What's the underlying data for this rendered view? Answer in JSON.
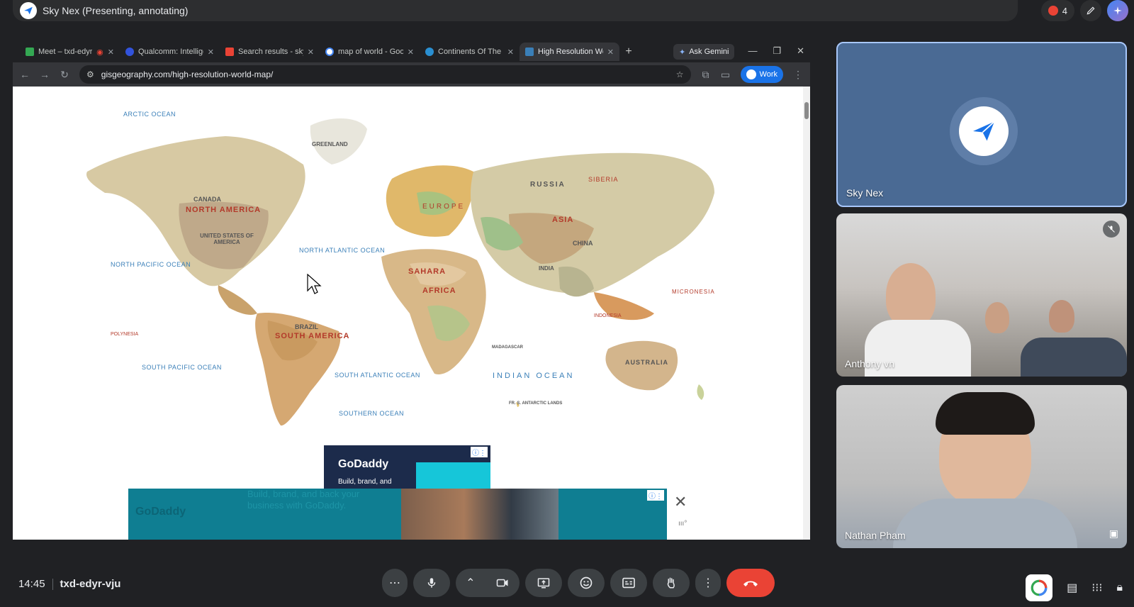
{
  "meet": {
    "presenter_title": "Sky Nex (Presenting, annotating)",
    "participant_count": "4",
    "time": "14:45",
    "meeting_code": "txd-edyr-vju"
  },
  "browser": {
    "tabs": [
      {
        "label": "Meet – txd-edyr",
        "color": "#34a853"
      },
      {
        "label": "Qualcomm: Intellige",
        "color": "#3253dc"
      },
      {
        "label": "Search results - sky",
        "color": "#ea4335"
      },
      {
        "label": "map of world - Goo",
        "color": "#4285f4"
      },
      {
        "label": "Continents Of The W",
        "color": "#2a8fd1"
      },
      {
        "label": "High Resolution Wo",
        "color": "#3a7fb8"
      }
    ],
    "ask_gemini": "Ask Gemini",
    "url": "gisgeography.com/high-resolution-world-map/",
    "profile": "Work"
  },
  "map_labels": {
    "arctic": "ARCTIC OCEAN",
    "greenland": "GREENLAND",
    "russia": "RUSSIA",
    "siberia": "SIBERIA",
    "canada": "CANADA",
    "north_america": "NORTH AMERICA",
    "usa": "UNITED STATES OF AMERICA",
    "north_atlantic": "NORTH ATLANTIC OCEAN",
    "north_pacific": "NORTH PACIFIC OCEAN",
    "asia": "ASIA",
    "china": "CHINA",
    "india": "INDIA",
    "sahara": "SAHARA",
    "africa": "AFRICA",
    "brazil": "BRAZIL",
    "south_america": "SOUTH AMERICA",
    "south_pacific": "SOUTH PACIFIC OCEAN",
    "south_atlantic": "SOUTH ATLANTIC OCEAN",
    "indian_ocean": "INDIAN OCEAN",
    "southern_ocean": "SOUTHERN OCEAN",
    "australia": "AUSTRALIA",
    "micronesia": "MICRONESIA",
    "polynesia": "POLYNESIA",
    "madagascar": "MADAGASCAR",
    "antarctic": "FR. S. ANTARCTIC LANDS",
    "europe": "EUROPE",
    "indonesia": "INDONESIA"
  },
  "ads": {
    "brand": "GoDaddy",
    "small_tagline": "Build, brand, and",
    "banner_tagline_1": "Build, brand, and back your",
    "banner_tagline_2": "business with GoDaddy."
  },
  "participants": [
    {
      "name": "Sky Nex",
      "avatar_icon": "paper-plane-icon"
    },
    {
      "name": "Anthony vn",
      "muted": true
    },
    {
      "name": "Nathan Pham"
    }
  ]
}
